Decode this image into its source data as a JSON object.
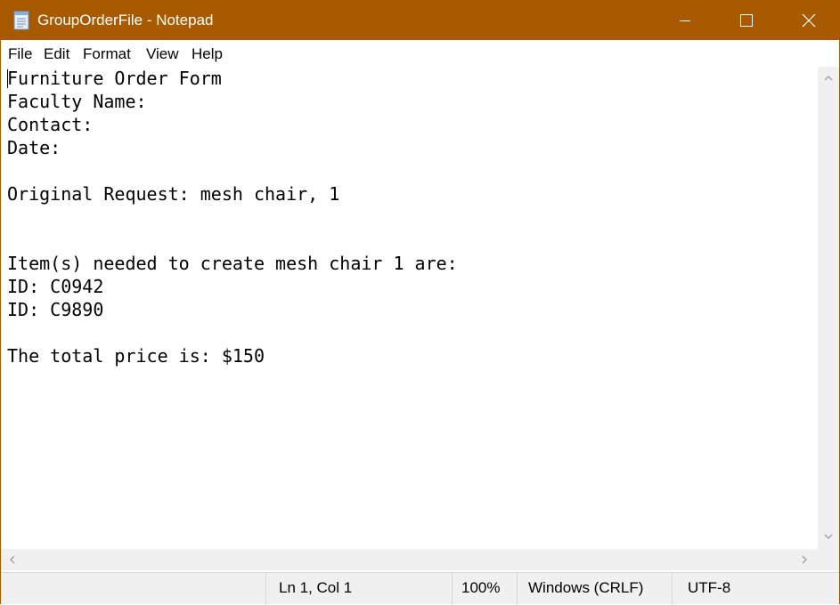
{
  "window": {
    "title": "GroupOrderFile - Notepad",
    "titlebar_color": "#a85a00",
    "controls": {
      "minimize_icon": "minimize-icon",
      "maximize_icon": "maximize-icon",
      "close_icon": "close-icon"
    }
  },
  "menu": {
    "items": [
      "File",
      "Edit",
      "Format",
      "View",
      "Help"
    ]
  },
  "document": {
    "lines": [
      "Furniture Order Form",
      "Faculty Name:",
      "Contact:",
      "Date:",
      "",
      "Original Request: mesh chair, 1",
      "",
      "",
      "Item(s) needed to create mesh chair 1 are:",
      "ID: C0942",
      "ID: C9890",
      "",
      "The total price is: $150"
    ]
  },
  "status": {
    "position": "Ln 1, Col 1",
    "zoom": "100%",
    "line_ending": "Windows (CRLF)",
    "encoding": "UTF-8"
  }
}
